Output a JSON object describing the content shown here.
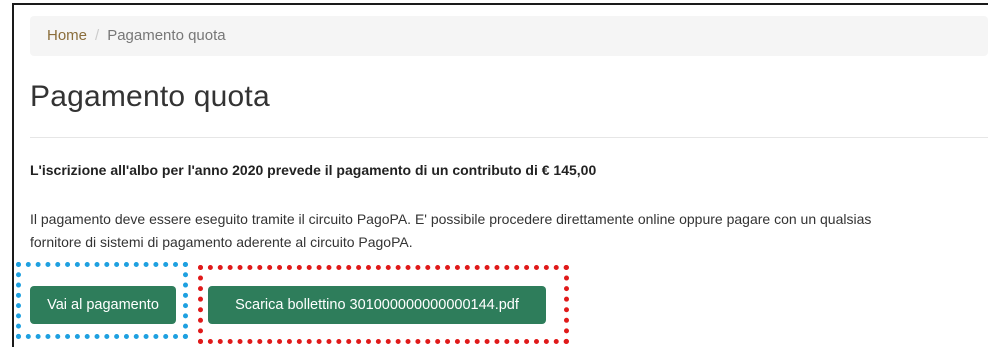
{
  "breadcrumb": {
    "home": "Home",
    "separator": "/",
    "current": "Pagamento quota"
  },
  "page": {
    "title": "Pagamento quota",
    "lead": "L'iscrizione all'albo per l'anno 2020 prevede il pagamento di un contributo di € 145,00",
    "info_line1": "Il pagamento deve essere eseguito tramite il circuito PagoPA. E' possibile procedere direttamente online oppure pagare con un qualsias",
    "info_line2": "fornitore di sistemi di pagamento aderente al circuito PagoPA."
  },
  "actions": {
    "pay_label": "Vai al pagamento",
    "download_label": "Scarica bollettino 301000000000000144.pdf"
  },
  "colors": {
    "button": "#2e7d5b",
    "highlight_blue": "#1ea0e0",
    "highlight_red": "#e01a1a",
    "breadcrumb_link": "#8a6d3b"
  }
}
